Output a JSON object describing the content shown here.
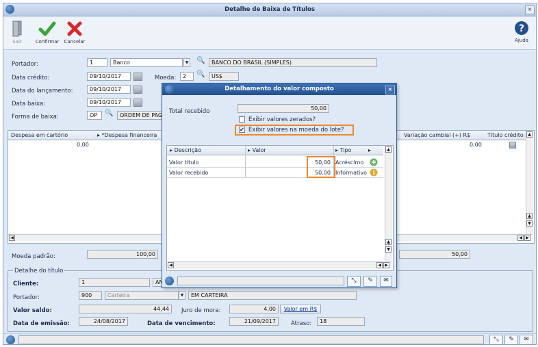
{
  "window": {
    "title": "Detalhe de Baixa de Títulos",
    "close": "×"
  },
  "toolbar": {
    "exit_label": "Sair",
    "confirm_label": "Confirmar",
    "cancel_label": "Cancelar",
    "help_label": "Ajuda"
  },
  "form": {
    "portador_label": "Portador:",
    "portador_code": "1",
    "portador_type": "Banco",
    "portador_name": "BANCO DO BRASIL (SIMPLES)",
    "data_credito_label": "Data crédito:",
    "data_credito": "09/10/2017",
    "moeda_label": "Moeda:",
    "moeda_code": "2",
    "moeda_name": "US$",
    "data_lancamento_label": "Data do lançamento:",
    "data_lancamento": "09/10/2017",
    "data_baixa_label": "Data baixa:",
    "data_baixa": "09/10/2017",
    "forma_baixa_label": "Forma de  baixa:",
    "forma_baixa_code": "OP",
    "forma_baixa_name": "ORDEM DE PAG"
  },
  "main_grid": {
    "headers": [
      "Despesa em cartório",
      "*Despesa financeira",
      "Variação cambial (+) R$",
      "Título crédito"
    ],
    "values": [
      "0,00",
      "0,00"
    ]
  },
  "moeda_padrao": {
    "label": "Moeda padrão:",
    "value": "100,00",
    "right_value": "50,00"
  },
  "detalhe": {
    "legend": "Detalhe do título",
    "cliente_label": "Cliente:",
    "cliente_code": "1",
    "cliente_name": "AN",
    "portador_label": "Portador:",
    "portador_code": "900",
    "portador_type": "Carteira",
    "portador_name": "EM CARTEIRA",
    "valor_saldo_label": "Valor saldo:",
    "valor_saldo": "44,44",
    "juro_label": "Juro de mora:",
    "juro": "4,00",
    "valor_rs_button": "Valor em R$",
    "emissao_label": "Data de emissão:",
    "emissao": "24/08/2017",
    "vencimento_label": "Data de vencimento:",
    "vencimento": "21/09/2017",
    "atraso_label": "Atraso:",
    "atraso": "18"
  },
  "dialog": {
    "title": "Detalhamento do valor composto",
    "total_label": "Total recebido",
    "total_value": "50,00",
    "exibir_zerados": "Exibir valores zerados?",
    "exibir_moeda": "Exibir valores na moeda do lote?",
    "headers": [
      "Descrição",
      "Valor",
      "Tipo"
    ],
    "rows": [
      {
        "descricao": "Valor título",
        "valor": "50,00",
        "tipo": "Acréscimo"
      },
      {
        "descricao": "Valor recebido",
        "valor": "50,00",
        "tipo": "Informativo"
      }
    ]
  },
  "colors": {
    "accent": "#234f8d",
    "highlight": "#f0862a",
    "confirm": "#3aa53a",
    "cancel": "#d8262a"
  }
}
